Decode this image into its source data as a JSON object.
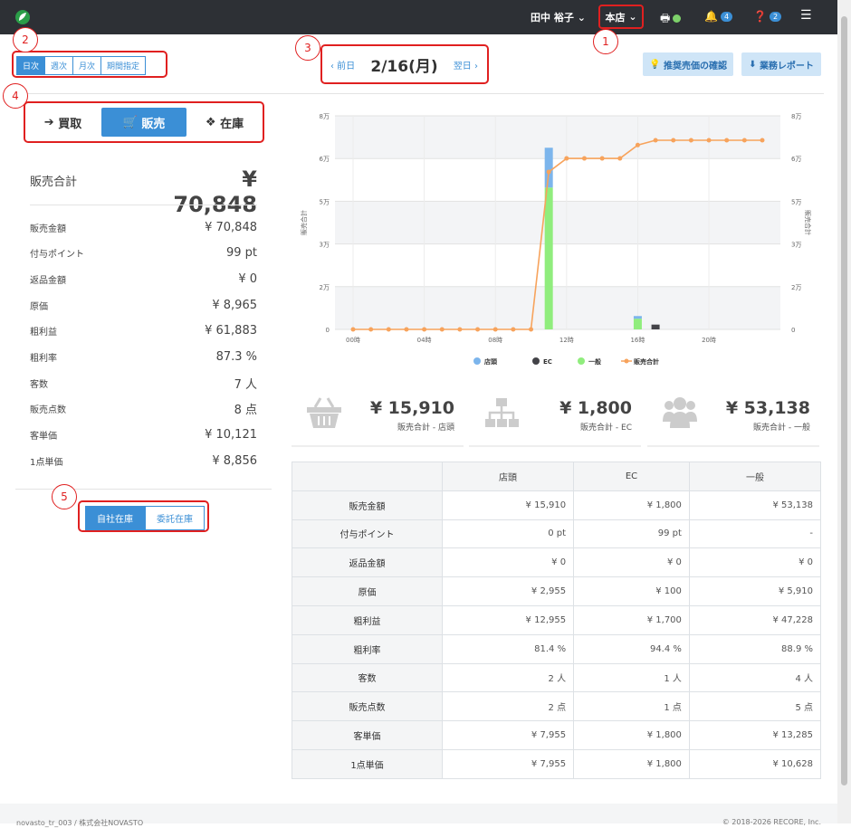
{
  "header": {
    "user": "田中 裕子",
    "store": "本店",
    "notif_count": "4",
    "help_count": "2"
  },
  "markers": [
    "1",
    "2",
    "3",
    "4",
    "5"
  ],
  "period_tabs": [
    "日次",
    "週次",
    "月次",
    "期間指定"
  ],
  "date_nav": {
    "prev": "‹ 前日",
    "date": "2/16(月)",
    "next": "翌日 ›"
  },
  "buttons": {
    "recommend": "推奨売価の確認",
    "report": "業務レポート"
  },
  "tabs": [
    "買取",
    "販売",
    "在庫"
  ],
  "summary": {
    "title": "販売合計",
    "value": "¥ 70,848",
    "rows": [
      {
        "label": "販売金額",
        "value": "¥ 70,848"
      },
      {
        "label": "付与ポイント",
        "value": "99 pt"
      },
      {
        "label": "返品金額",
        "value": "¥ 0"
      },
      {
        "label": "原価",
        "value": "¥ 8,965"
      },
      {
        "label": "粗利益",
        "value": "¥ 61,883"
      },
      {
        "label": "粗利率",
        "value": "87.3 %"
      },
      {
        "label": "客数",
        "value": "7 人"
      },
      {
        "label": "販売点数",
        "value": "8 点"
      },
      {
        "label": "客単価",
        "value": "¥ 10,121"
      },
      {
        "label": "1点単価",
        "value": "¥ 8,856"
      }
    ]
  },
  "stock_toggle": [
    "自社在庫",
    "委託在庫"
  ],
  "chart_data": {
    "type": "bar+line",
    "x_ticks": [
      "00時",
      "04時",
      "08時",
      "12時",
      "16時",
      "20時"
    ],
    "y_ticks": [
      "0",
      "2万",
      "3万",
      "5万",
      "6万",
      "8万"
    ],
    "ylabel_left": "販売合計",
    "ylabel_right": "販売合計",
    "ylim": [
      0,
      80000
    ],
    "hours": [
      0,
      1,
      2,
      3,
      4,
      5,
      6,
      7,
      8,
      9,
      10,
      11,
      12,
      13,
      14,
      15,
      16,
      17,
      18,
      19,
      20,
      21,
      22,
      23
    ],
    "series": [
      {
        "name": "店頭",
        "color": "#7cb5ec",
        "type": "bar",
        "values": {
          "11": 14910,
          "16": 1000
        }
      },
      {
        "name": "EC",
        "color": "#434348",
        "type": "bar",
        "values": {
          "17": 1800
        }
      },
      {
        "name": "一般",
        "color": "#90ed7d",
        "type": "bar",
        "values": {
          "11": 53138,
          "16": 4000
        }
      },
      {
        "name": "販売合計",
        "color": "#f7a35c",
        "type": "line",
        "values": [
          0,
          0,
          0,
          0,
          0,
          0,
          0,
          0,
          0,
          0,
          0,
          59000,
          64048,
          64048,
          64048,
          64048,
          69048,
          70848,
          70848,
          70848,
          70848,
          70848,
          70848,
          70848
        ]
      }
    ],
    "legend_position": "bottom"
  },
  "kpis": [
    {
      "value": "¥ 15,910",
      "label": "販売合計 - 店頭",
      "icon": "basket-icon"
    },
    {
      "value": "¥ 1,800",
      "label": "販売合計 - EC",
      "icon": "sitemap-icon"
    },
    {
      "value": "¥ 53,138",
      "label": "販売合計 - 一般",
      "icon": "users-icon"
    }
  ],
  "table": {
    "headers": [
      "",
      "店頭",
      "EC",
      "一般"
    ],
    "rows": [
      [
        "販売金額",
        "¥ 15,910",
        "¥ 1,800",
        "¥ 53,138"
      ],
      [
        "付与ポイント",
        "0 pt",
        "99 pt",
        "-"
      ],
      [
        "返品金額",
        "¥ 0",
        "¥ 0",
        "¥ 0"
      ],
      [
        "原価",
        "¥ 2,955",
        "¥ 100",
        "¥ 5,910"
      ],
      [
        "粗利益",
        "¥ 12,955",
        "¥ 1,700",
        "¥ 47,228"
      ],
      [
        "粗利率",
        "81.4 %",
        "94.4 %",
        "88.9 %"
      ],
      [
        "客数",
        "2 人",
        "1 人",
        "4 人"
      ],
      [
        "販売点数",
        "2 点",
        "1 点",
        "5 点"
      ],
      [
        "客単価",
        "¥ 7,955",
        "¥ 1,800",
        "¥ 13,285"
      ],
      [
        "1点単価",
        "¥ 7,955",
        "¥ 1,800",
        "¥ 10,628"
      ]
    ]
  },
  "footer": {
    "left": "novasto_tr_003 / 株式会社NOVASTO",
    "right": "© 2018-2026 RECORE, Inc."
  }
}
